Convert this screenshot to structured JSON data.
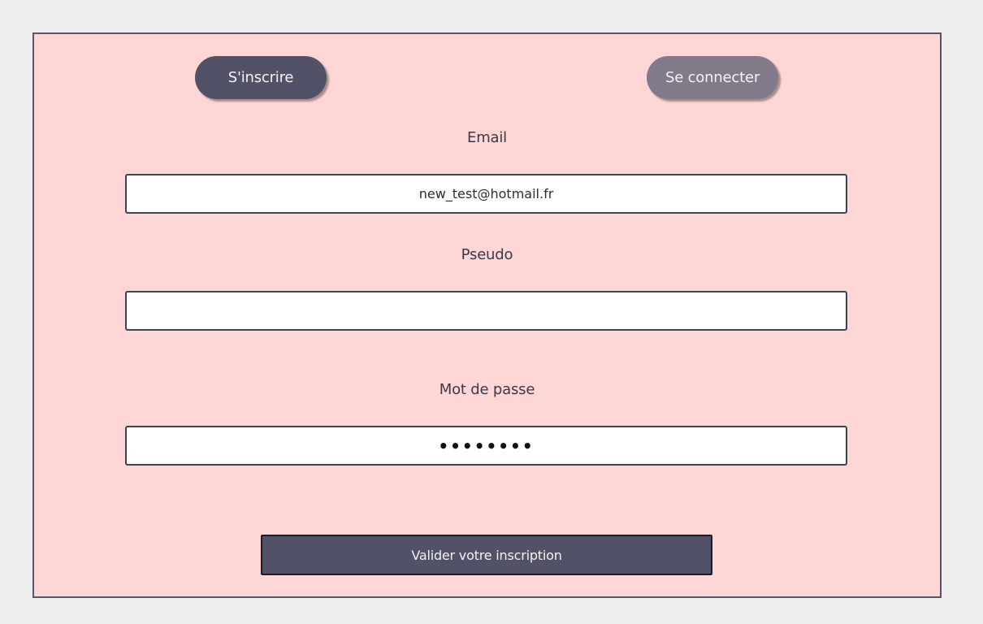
{
  "tabs": {
    "signup_label": "S'inscrire",
    "login_label": "Se connecter"
  },
  "form": {
    "email": {
      "label": "Email",
      "value": "new_test@hotmail.fr"
    },
    "pseudo": {
      "label": "Pseudo",
      "value": ""
    },
    "password": {
      "label": "Mot de passe",
      "value": "••••••••"
    },
    "submit_label": "Valider votre inscription"
  },
  "colors": {
    "background": "#eeeeee",
    "panel": "#ffd6d6",
    "primary_button": "#515267",
    "secondary_button": "#827a89"
  }
}
